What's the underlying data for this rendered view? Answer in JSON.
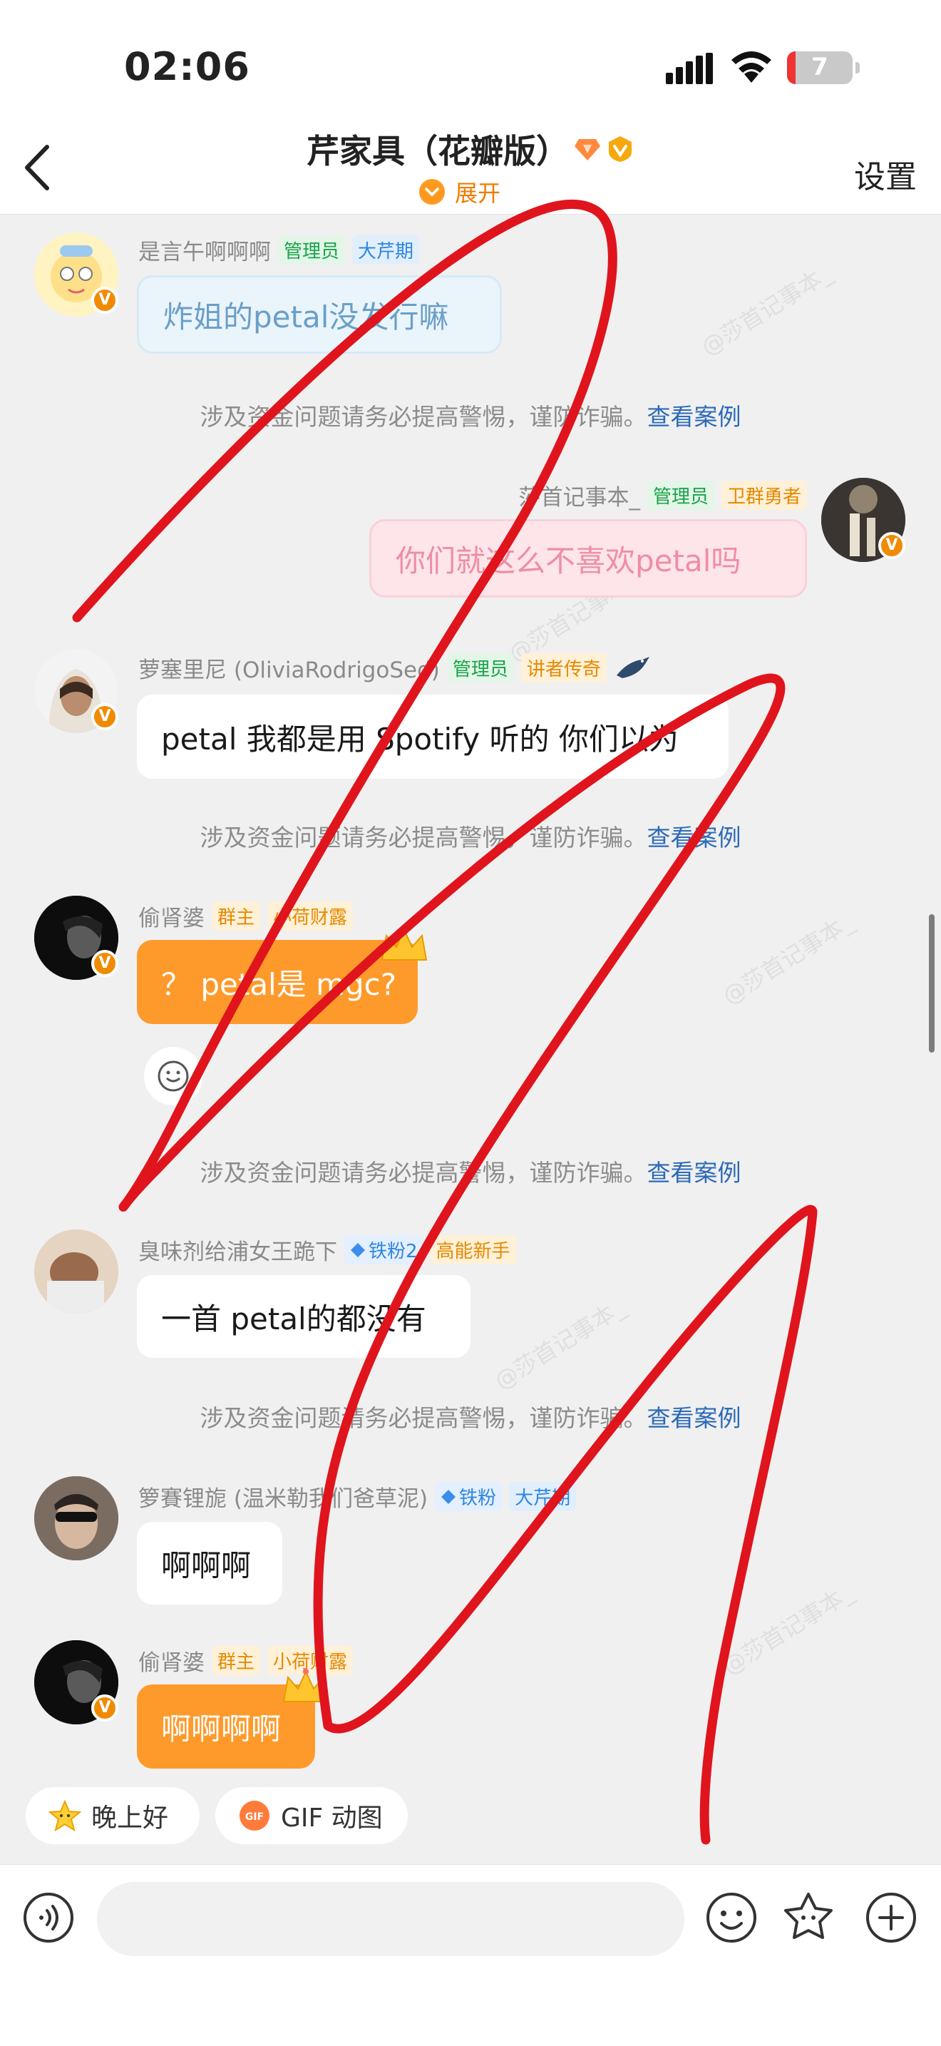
{
  "status": {
    "time": "02:06",
    "battery": "7"
  },
  "header": {
    "title": "芹家具（花瓣版）",
    "expand_label": "展开",
    "settings_label": "设置"
  },
  "system_notice": {
    "text": "涉及资金问题请务必提高警惕，谨防诈骗。",
    "link": "查看案例"
  },
  "messages": [
    {
      "name": "是言午啊啊啊",
      "tags": [
        "管理员",
        "大芹期"
      ],
      "text": "炸姐的petal没发行嘛"
    },
    {
      "name": "莎首记事本_",
      "tags": [
        "管理员",
        "卫群勇者"
      ],
      "text": "你们就这么不喜欢petal吗"
    },
    {
      "name": "萝塞里尼 (OliviaRodrigoSed)",
      "tags": [
        "管理员",
        "讲者传奇"
      ],
      "text": "petal 我都是用 Spotify 听的 你们以为"
    },
    {
      "name": "偷肾婆",
      "tags": [
        "群主",
        "小荷财露"
      ],
      "text": "？ petal是 mgc?"
    },
    {
      "name": "臭味剂给浦女王跪下",
      "tags": [
        "铁粉2",
        "高能新手"
      ],
      "text": "一首 petal的都没有"
    },
    {
      "name": "箩賽锂旎 (温米勒我们爸草泥)",
      "tags": [
        "铁粉",
        "大芹期"
      ],
      "text": "啊啊啊"
    },
    {
      "name": "偷肾婆",
      "tags": [
        "群主",
        "小荷财露"
      ],
      "text": "啊啊啊啊"
    }
  ],
  "quick_replies": [
    "晚上好",
    "GIF 动图"
  ],
  "watermark": "@莎首记事本_",
  "icons": [
    "back-chevron-icon",
    "diamond-icon",
    "vip-badge-icon",
    "chevron-down-icon",
    "voice-icon",
    "emoji-icon",
    "sticker-icon",
    "plus-icon",
    "star-emoji-icon",
    "gif-icon",
    "crown-icon",
    "reaction-icon"
  ],
  "colors": {
    "accent": "#fe9a2b",
    "link": "#2c6ab8",
    "scribble": "#e0141c"
  }
}
